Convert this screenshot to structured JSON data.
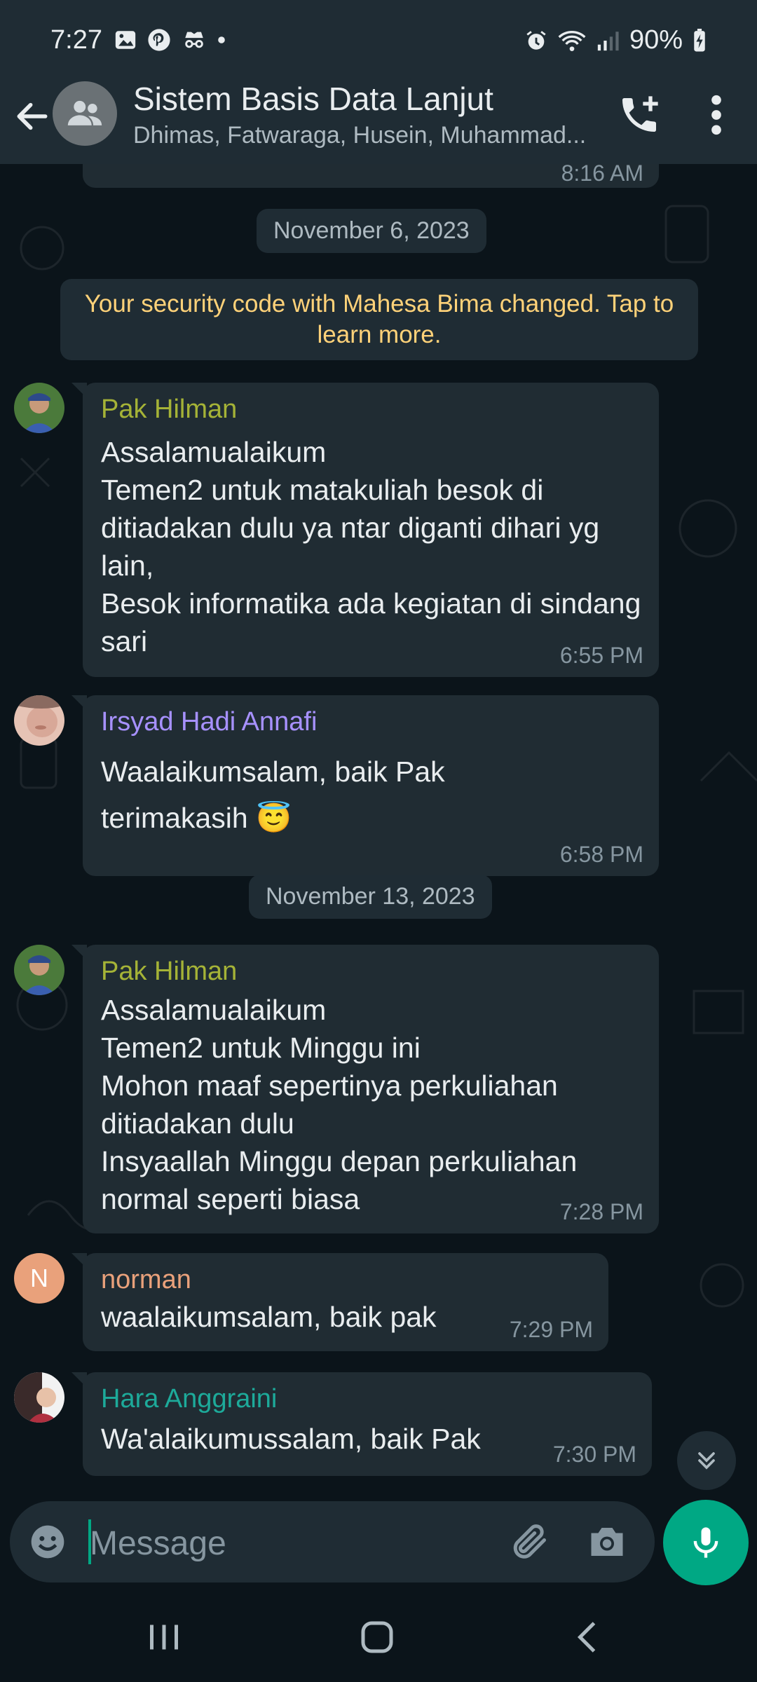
{
  "status_bar": {
    "time": "7:27",
    "battery": "90%"
  },
  "header": {
    "title": "Sistem Basis Data Lanjut",
    "subtitle": "Dhimas, Fatwaraga, Husein, Muhammad..."
  },
  "chat": {
    "previous_time": "8:16 AM",
    "date_1": "November 6, 2023",
    "system_message": "Your security code with Mahesa Bima changed. Tap to learn more.",
    "date_2": "November 13, 2023",
    "messages": [
      {
        "sender": "Pak Hilman",
        "color": "#a5b337",
        "text": "Assalamualaikum\nTemen2 untuk matakuliah besok di ditiadakan dulu ya ntar diganti dihari yg lain,\nBesok informatika ada kegiatan di sindang sari",
        "time": "6:55 PM"
      },
      {
        "sender": "Irsyad Hadi Annafi",
        "color": "#a791ff",
        "text": "Waalaikumsalam, baik Pak terimakasih 😇",
        "time": "6:58 PM"
      },
      {
        "sender": "Pak Hilman",
        "color": "#a5b337",
        "text": "Assalamualaikum\nTemen2 untuk Minggu ini\nMohon maaf sepertinya perkuliahan ditiadakan dulu\nInsyaallah Minggu depan perkuliahan normal seperti biasa",
        "time": "7:28 PM"
      },
      {
        "sender": "norman",
        "color": "#e9a17b",
        "avatar_letter": "N",
        "text": "waalaikumsalam, baik pak",
        "time": "7:29 PM"
      },
      {
        "sender": "Hara Anggraini",
        "color": "#1daa9a",
        "text": "Wa'alaikumussalam, baik Pak",
        "time": "7:30 PM"
      }
    ]
  },
  "input": {
    "placeholder": "Message"
  },
  "icons": {
    "back": "arrow-left-icon",
    "group": "group-avatar-icon",
    "call": "add-call-icon",
    "menu": "more-vert-icon",
    "emoji": "emoji-icon",
    "attach": "paperclip-icon",
    "camera": "camera-icon",
    "mic": "mic-icon",
    "scroll": "double-chevron-down-icon"
  },
  "colors": {
    "accent": "#00a884",
    "bubble": "#202c33",
    "bg": "#0b141a",
    "header": "#1f2c34",
    "system_text": "#ffd279"
  }
}
